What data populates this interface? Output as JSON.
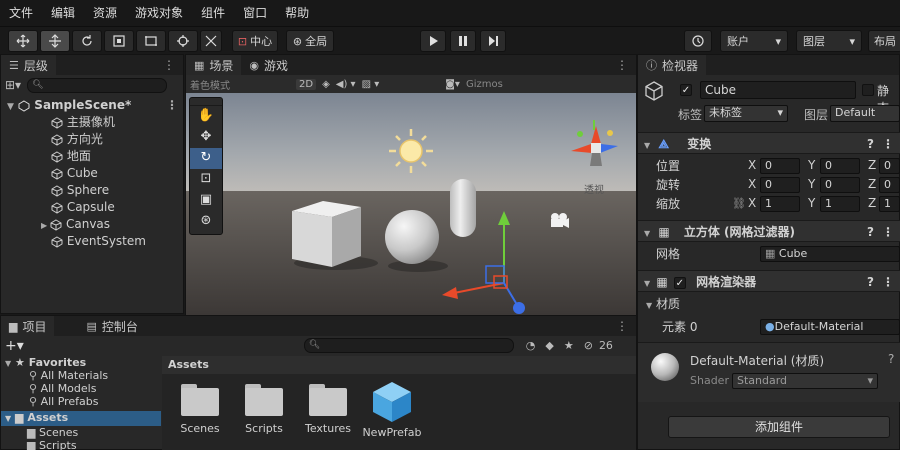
{
  "menu": [
    "文件",
    "编辑",
    "资源",
    "游戏对象",
    "组件",
    "窗口",
    "帮助"
  ],
  "toolbar": {
    "center_label": "中心",
    "global_label": "全局",
    "right1": "账户",
    "right2": "图层",
    "layout": "布局"
  },
  "hierarchy": {
    "tab": "层级",
    "items": [
      {
        "label": "SampleScene*"
      },
      {
        "label": "主摄像机"
      },
      {
        "label": "方向光"
      },
      {
        "label": "地面"
      },
      {
        "label": "Cube"
      },
      {
        "label": "Sphere"
      },
      {
        "label": "Capsule"
      },
      {
        "label": "Canvas"
      },
      {
        "label": "EventSystem"
      }
    ]
  },
  "scene": {
    "tab_scene": "场景",
    "tab_game": "游戏",
    "toolbar_shading": "着色模式",
    "toolbar_2d": "2D",
    "toolbar_gizmo": "Gizmos",
    "persp_label": "透视"
  },
  "project": {
    "tab_project": "项目",
    "tab_console": "控制台",
    "favorites": "Favorites",
    "fav_items": [
      "All Materials",
      "All Models",
      "All Prefabs"
    ],
    "assets": "Assets",
    "assets_children": [
      "Scenes",
      "Scripts"
    ],
    "assets_header": "Assets",
    "asset_items": [
      "Scenes",
      "Scripts",
      "Textures",
      "NewPrefab"
    ],
    "count": "26"
  },
  "inspector": {
    "tab": "检视器",
    "object_name": "Cube",
    "static_label": "静态",
    "tag_label": "标签",
    "tag_value": "未标签",
    "layer_label": "图层",
    "layer_value": "Default",
    "transform": {
      "title": "变换",
      "rows": [
        {
          "label": "位置",
          "x": "0",
          "y": "0",
          "z": "0"
        },
        {
          "label": "旋转",
          "x": "0",
          "y": "0",
          "z": "0"
        },
        {
          "label": "缩放",
          "x": "1",
          "y": "1",
          "z": "1"
        }
      ]
    },
    "mesh_filter": {
      "title": "立方体 (网格过滤器)",
      "mesh_label": "网格",
      "mesh_value": "Cube"
    },
    "mesh_renderer": {
      "title": "网格渲染器",
      "materials_label": "材质",
      "element_label": "元素 0",
      "element_value": "Default-Material"
    },
    "material": {
      "name": "Default-Material (材质)",
      "shader_label": "Shader",
      "shader_value": "Standard"
    },
    "add_component": "添加组件"
  },
  "colors": {
    "selection": "#2c5d87",
    "panel": "#282828",
    "accent_blue": "#3d7bbf"
  }
}
